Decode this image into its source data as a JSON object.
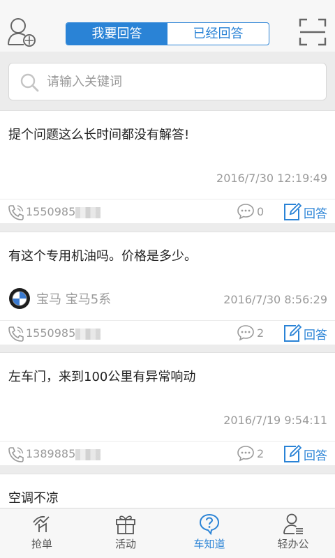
{
  "header": {
    "tabs": [
      {
        "label": "我要回答",
        "active": true
      },
      {
        "label": "已经回答",
        "active": false
      }
    ]
  },
  "search": {
    "placeholder": "请输入关键词"
  },
  "questions": [
    {
      "title": "提个问题这么长时间都没有解答!",
      "car": "",
      "time": "2016/7/30 12:19:49",
      "phone": "1550985",
      "comments": "0",
      "answer_label": "回答"
    },
    {
      "title": "有这个专用机油吗。价格是多少。",
      "car": "宝马 宝马5系",
      "time": "2016/7/30 8:56:29",
      "phone": "1550985",
      "comments": "2",
      "answer_label": "回答"
    },
    {
      "title": "左车门，来到100公里有异常响动",
      "car": "",
      "time": "2016/7/19 9:54:11",
      "phone": "1389885",
      "comments": "2",
      "answer_label": "回答"
    },
    {
      "title": "空调不凉"
    }
  ],
  "tabbar": [
    {
      "label": "抢单",
      "icon": "grab-order-icon"
    },
    {
      "label": "活动",
      "icon": "gift-icon"
    },
    {
      "label": "车知道",
      "icon": "question-bubble-icon",
      "active": true
    },
    {
      "label": "轻办公",
      "icon": "office-user-icon"
    }
  ],
  "colors": {
    "accent": "#2a83d6",
    "muted_text": "#9a9a9a",
    "background": "#ececec"
  }
}
